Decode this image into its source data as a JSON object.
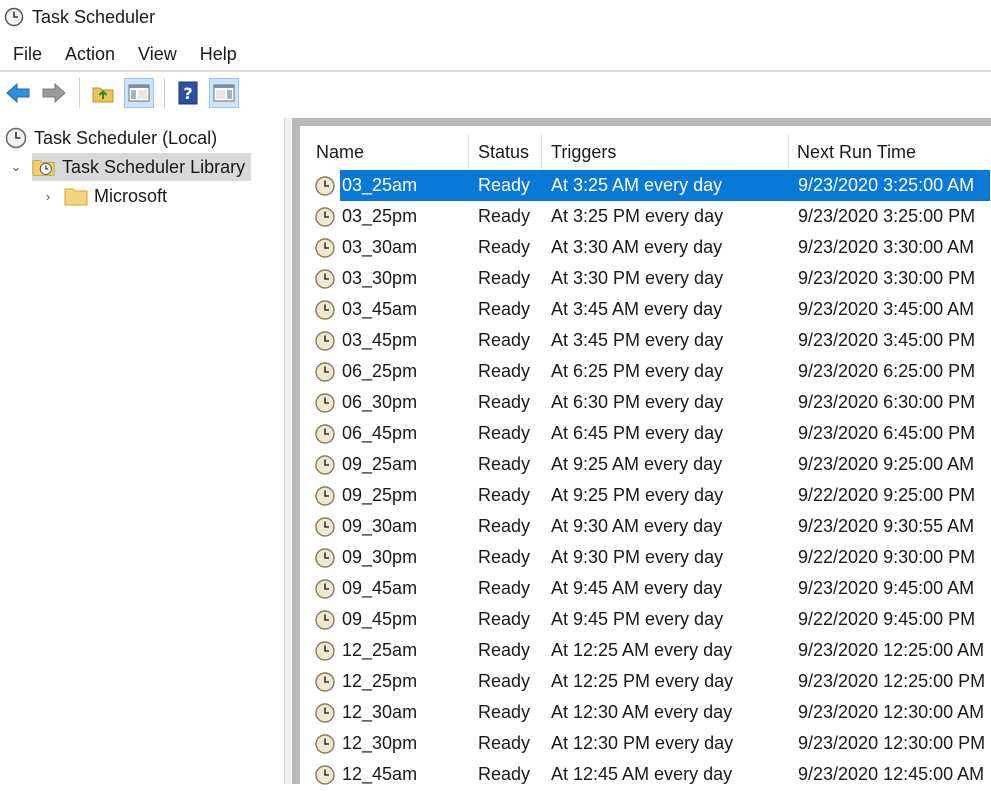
{
  "window": {
    "title": "Task Scheduler"
  },
  "menu": [
    "File",
    "Action",
    "View",
    "Help"
  ],
  "toolbar": {
    "buttons": [
      {
        "name": "back-arrow-icon"
      },
      {
        "name": "forward-arrow-icon"
      },
      {
        "name": "folder-up-icon"
      },
      {
        "name": "show-hide-console-tree-icon"
      },
      {
        "name": "help-icon"
      },
      {
        "name": "show-hide-action-pane-icon"
      }
    ]
  },
  "tree": {
    "root": "Task Scheduler (Local)",
    "library": "Task Scheduler Library",
    "child": "Microsoft"
  },
  "list": {
    "columns": [
      "Name",
      "Status",
      "Triggers",
      "Next Run Time"
    ],
    "rows": [
      {
        "name": "03_25am",
        "status": "Ready",
        "trigger": "At 3:25 AM every day",
        "next": "9/23/2020 3:25:00 AM"
      },
      {
        "name": "03_25pm",
        "status": "Ready",
        "trigger": "At 3:25 PM every day",
        "next": "9/23/2020 3:25:00 PM"
      },
      {
        "name": "03_30am",
        "status": "Ready",
        "trigger": "At 3:30 AM every day",
        "next": "9/23/2020 3:30:00 AM"
      },
      {
        "name": "03_30pm",
        "status": "Ready",
        "trigger": "At 3:30 PM every day",
        "next": "9/23/2020 3:30:00 PM"
      },
      {
        "name": "03_45am",
        "status": "Ready",
        "trigger": "At 3:45 AM every day",
        "next": "9/23/2020 3:45:00 AM"
      },
      {
        "name": "03_45pm",
        "status": "Ready",
        "trigger": "At 3:45 PM every day",
        "next": "9/23/2020 3:45:00 PM"
      },
      {
        "name": "06_25pm",
        "status": "Ready",
        "trigger": "At 6:25 PM every day",
        "next": "9/23/2020 6:25:00 PM"
      },
      {
        "name": "06_30pm",
        "status": "Ready",
        "trigger": "At 6:30 PM every day",
        "next": "9/23/2020 6:30:00 PM"
      },
      {
        "name": "06_45pm",
        "status": "Ready",
        "trigger": "At 6:45 PM every day",
        "next": "9/23/2020 6:45:00 PM"
      },
      {
        "name": "09_25am",
        "status": "Ready",
        "trigger": "At 9:25 AM every day",
        "next": "9/23/2020 9:25:00 AM"
      },
      {
        "name": "09_25pm",
        "status": "Ready",
        "trigger": "At 9:25 PM every day",
        "next": "9/22/2020 9:25:00 PM"
      },
      {
        "name": "09_30am",
        "status": "Ready",
        "trigger": "At 9:30 AM every day",
        "next": "9/23/2020 9:30:55 AM"
      },
      {
        "name": "09_30pm",
        "status": "Ready",
        "trigger": "At 9:30 PM every day",
        "next": "9/22/2020 9:30:00 PM"
      },
      {
        "name": "09_45am",
        "status": "Ready",
        "trigger": "At 9:45 AM every day",
        "next": "9/23/2020 9:45:00 AM"
      },
      {
        "name": "09_45pm",
        "status": "Ready",
        "trigger": "At 9:45 PM every day",
        "next": "9/22/2020 9:45:00 PM"
      },
      {
        "name": "12_25am",
        "status": "Ready",
        "trigger": "At 12:25 AM every day",
        "next": "9/23/2020 12:25:00 AM"
      },
      {
        "name": "12_25pm",
        "status": "Ready",
        "trigger": "At 12:25 PM every day",
        "next": "9/23/2020 12:25:00 PM"
      },
      {
        "name": "12_30am",
        "status": "Ready",
        "trigger": "At 12:30 AM every day",
        "next": "9/23/2020 12:30:00 AM"
      },
      {
        "name": "12_30pm",
        "status": "Ready",
        "trigger": "At 12:30 PM every day",
        "next": "9/23/2020 12:30:00 PM"
      },
      {
        "name": "12_45am",
        "status": "Ready",
        "trigger": "At 12:45 AM every day",
        "next": "9/23/2020 12:45:00 AM"
      }
    ],
    "selected_index": 0
  },
  "colors": {
    "selection": "#0a78d7",
    "tree_selection": "#d9d9d9",
    "pane_border": "#b9b9b9"
  }
}
